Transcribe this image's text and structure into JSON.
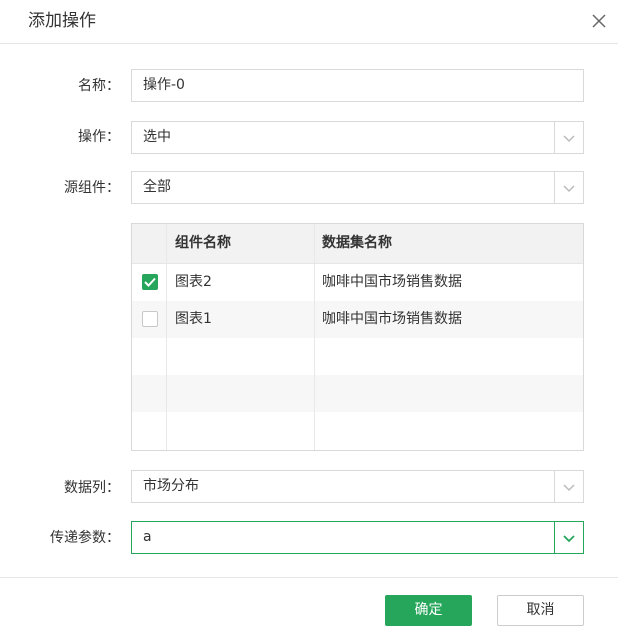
{
  "dialog": {
    "title": "添加操作",
    "close_icon": "close-icon"
  },
  "form": {
    "name_label": "名称：",
    "name_value": "操作-0",
    "action_label": "操作：",
    "action_value": "选中",
    "source_label": "源组件：",
    "source_value": "全部",
    "datacol_label": "数据列：",
    "datacol_value": "市场分布",
    "param_label": "传递参数：",
    "param_value": "a"
  },
  "table": {
    "headers": [
      "组件名称",
      "数据集名称"
    ],
    "rows": [
      {
        "checked": true,
        "component": "图表2",
        "dataset": "咖啡中国市场销售数据"
      },
      {
        "checked": false,
        "component": "图表1",
        "dataset": "咖啡中国市场销售数据"
      }
    ]
  },
  "footer": {
    "ok_label": "确定",
    "cancel_label": "取消"
  },
  "colors": {
    "accent": "#26a65b"
  }
}
